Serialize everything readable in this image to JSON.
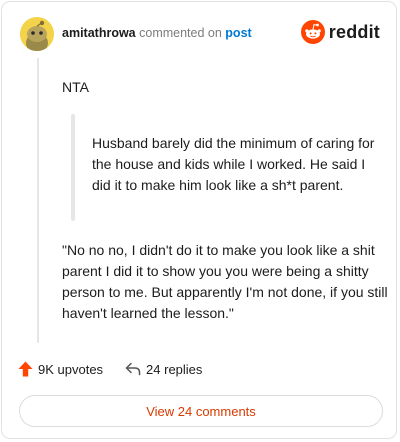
{
  "header": {
    "username": "amitathrowa",
    "action_text": "commented on",
    "post_link": "post",
    "brand": "reddit",
    "brand_color": "#ff4500"
  },
  "comment": {
    "opening": "NTA",
    "quote": "Husband barely did the minimum of caring for the house and kids while I worked. He said I did it to make him look like a sh*t parent.",
    "body": "\"No no no, I didn't do it to make you look like a shit parent I did it to show you you were being a shitty person to me. But apparently I'm not done, if you still haven't learned the lesson.\""
  },
  "actions": {
    "upvotes": "9K upvotes",
    "replies": "24 replies",
    "upvote_icon": "upvote-arrow-icon",
    "reply_icon": "reply-arrow-icon"
  },
  "footer": {
    "view_comments": "View 24 comments",
    "accent_color": "#d93a00"
  }
}
